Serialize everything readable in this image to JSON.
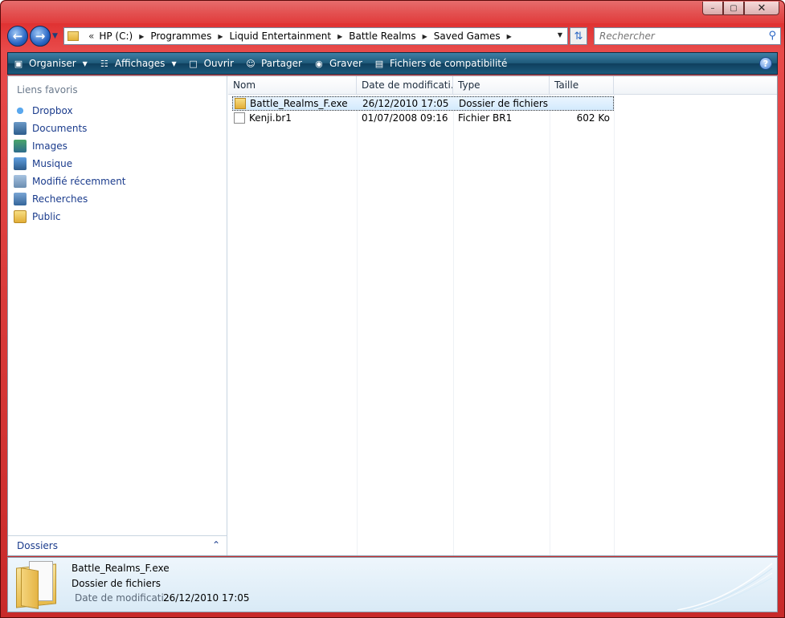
{
  "window": {
    "caption": {
      "minimize": "–",
      "maximize": "▢",
      "close": "✕"
    }
  },
  "nav": {
    "back_icon": "back-arrow-icon",
    "forward_icon": "forward-arrow-icon",
    "overflow": "«",
    "breadcrumbs": [
      "HP (C:)",
      "Programmes",
      "Liquid Entertainment",
      "Battle Realms",
      "Saved Games"
    ],
    "search_placeholder": "Rechercher"
  },
  "toolbar": {
    "organize": "Organiser",
    "views": "Affichages",
    "open": "Ouvrir",
    "share": "Partager",
    "burn": "Graver",
    "compat": "Fichiers de compatibilité",
    "help": "?"
  },
  "sidebar": {
    "heading": "Liens favoris",
    "items": [
      {
        "label": "Dropbox",
        "icon": "dropbox-icon"
      },
      {
        "label": "Documents",
        "icon": "documents-icon"
      },
      {
        "label": "Images",
        "icon": "images-icon"
      },
      {
        "label": "Musique",
        "icon": "music-icon"
      },
      {
        "label": "Modifié récemment",
        "icon": "recent-icon"
      },
      {
        "label": "Recherches",
        "icon": "searches-icon"
      },
      {
        "label": "Public",
        "icon": "public-folder-icon"
      }
    ],
    "folders_label": "Dossiers"
  },
  "files": {
    "columns": [
      "Nom",
      "Date de modificati...",
      "Type",
      "Taille"
    ],
    "rows": [
      {
        "name": "Battle_Realms_F.exe",
        "date": "26/12/2010 17:05",
        "type": "Dossier de fichiers",
        "size": "",
        "icon": "folder-icon",
        "selected": true
      },
      {
        "name": "Kenji.br1",
        "date": "01/07/2008 09:16",
        "type": "Fichier BR1",
        "size": "602 Ko",
        "icon": "file-icon",
        "selected": false
      }
    ]
  },
  "details": {
    "name": "Battle_Realms_F.exe",
    "type": "Dossier de fichiers",
    "date_label": "Date de modificati...",
    "date_value": "26/12/2010 17:05"
  }
}
